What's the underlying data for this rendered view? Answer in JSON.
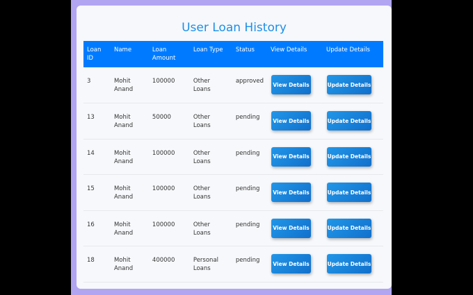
{
  "title": "User Loan History",
  "headers": [
    "Loan ID",
    "Name",
    "Loan Amount",
    "Loan Type",
    "Status",
    "View Details",
    "Update Details"
  ],
  "rows": [
    {
      "id": "3",
      "name": "Mohit Anand",
      "amount": "100000",
      "type": "Other Loans",
      "status": "approved"
    },
    {
      "id": "13",
      "name": "Mohit Anand",
      "amount": "50000",
      "type": "Other Loans",
      "status": "pending"
    },
    {
      "id": "14",
      "name": "Mohit Anand",
      "amount": "100000",
      "type": "Other Loans",
      "status": "pending"
    },
    {
      "id": "15",
      "name": "Mohit Anand",
      "amount": "100000",
      "type": "Other Loans",
      "status": "pending"
    },
    {
      "id": "16",
      "name": "Mohit Anand",
      "amount": "100000",
      "type": "Other Loans",
      "status": "pending"
    },
    {
      "id": "18",
      "name": "Mohit Anand",
      "amount": "400000",
      "type": "Personal Loans",
      "status": "pending"
    }
  ],
  "view_label": "View Details",
  "update_label": "Update Details"
}
